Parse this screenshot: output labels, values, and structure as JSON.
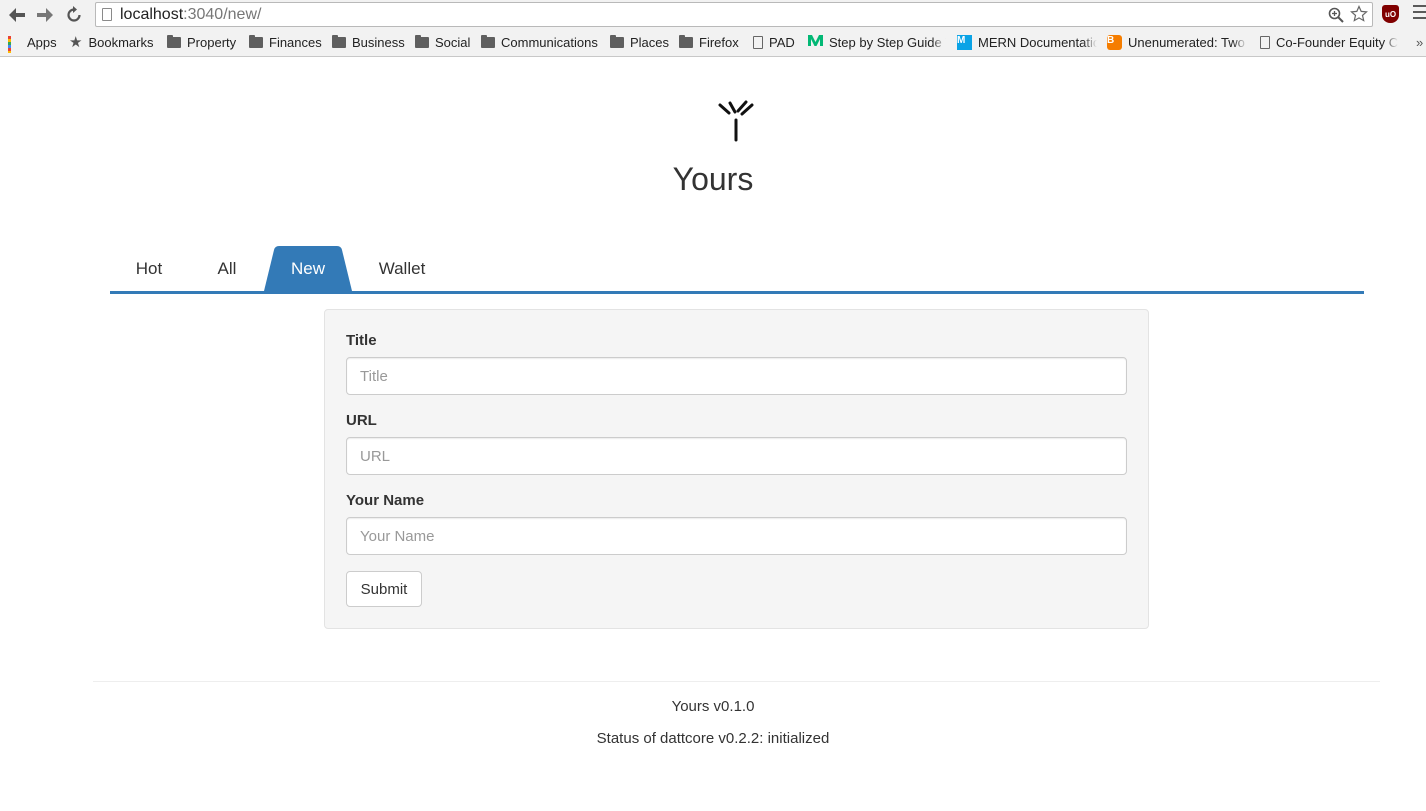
{
  "browser": {
    "url_host": "localhost",
    "url_path": ":3040/new/",
    "bookmarks": [
      {
        "label": "Apps",
        "icon": "apps-icon"
      },
      {
        "label": "Bookmarks",
        "icon": "star-icon"
      },
      {
        "label": "Property",
        "icon": "folder-icon"
      },
      {
        "label": "Finances",
        "icon": "folder-icon"
      },
      {
        "label": "Business",
        "icon": "folder-icon"
      },
      {
        "label": "Social",
        "icon": "folder-icon"
      },
      {
        "label": "Communications",
        "icon": "folder-icon"
      },
      {
        "label": "Places",
        "icon": "folder-icon"
      },
      {
        "label": "Firefox",
        "icon": "folder-icon"
      },
      {
        "label": "PAD",
        "icon": "page-icon"
      },
      {
        "label": "Step by Step Guide T",
        "icon": "medium-icon"
      },
      {
        "label": "MERN Documentatio",
        "icon": "m-icon"
      },
      {
        "label": "Unenumerated: Two",
        "icon": "blogger-icon"
      },
      {
        "label": "Co-Founder Equity C",
        "icon": "page-icon"
      }
    ],
    "overflow_label": "»",
    "extension_badge": "uO"
  },
  "site": {
    "title": "Yours"
  },
  "tabs": [
    {
      "label": "Hot",
      "active": false
    },
    {
      "label": "All",
      "active": false
    },
    {
      "label": "New",
      "active": true
    },
    {
      "label": "Wallet",
      "active": false
    }
  ],
  "form": {
    "title_label": "Title",
    "title_placeholder": "Title",
    "title_value": "",
    "url_label": "URL",
    "url_placeholder": "URL",
    "url_value": "",
    "name_label": "Your Name",
    "name_placeholder": "Your Name",
    "name_value": "",
    "submit_label": "Submit"
  },
  "footer": {
    "version": "Yours v0.1.0",
    "status": "Status of dattcore v0.2.2: initialized"
  },
  "colors": {
    "accent": "#337ab7",
    "panel_bg": "#f5f5f5"
  }
}
